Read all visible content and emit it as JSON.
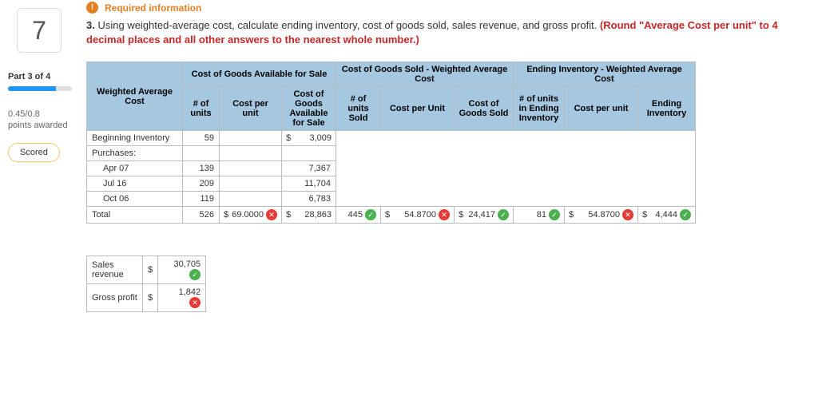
{
  "sidebar": {
    "question_number": "7",
    "part_label": "Part 3 of 4",
    "points": "0.45/0.8",
    "points_sub": "points awarded",
    "scored": "Scored"
  },
  "required_label": "Required information",
  "question_prefix": "3. ",
  "question_text": "Using weighted-average cost, calculate ending inventory, cost of goods sold, sales revenue, and gross profit. ",
  "question_red": "(Round \"Average Cost per unit\" to 4 decimal places and all other answers to the nearest whole number.)",
  "table": {
    "corner_header": "Weighted Average Cost",
    "group_headers": {
      "g1": "Cost of Goods Available for Sale",
      "g2": "Cost of Goods Sold - Weighted Average Cost",
      "g3": "Ending Inventory - Weighted Average Cost"
    },
    "sub_headers": {
      "c1": "# of units",
      "c2": "Cost per unit",
      "c3": "Cost of Goods Available for Sale",
      "c4": "# of units Sold",
      "c5": "Cost per Unit",
      "c6": "Cost of Goods Sold",
      "c7": "# of units in Ending Inventory",
      "c8": "Cost per unit",
      "c9": "Ending Inventory"
    },
    "rows": {
      "r1": {
        "label": "Beginning Inventory",
        "units": "59",
        "cga_sym": "$",
        "cga": "3,009"
      },
      "r2": {
        "label": "Purchases:"
      },
      "r3": {
        "label": "Apr 07",
        "units": "139",
        "cga": "7,367"
      },
      "r4": {
        "label": "Jul 16",
        "units": "209",
        "cga": "11,704"
      },
      "r5": {
        "label": "Oct 06",
        "units": "119",
        "cga": "6,783"
      },
      "r6": {
        "label": "Total",
        "units": "526",
        "cpu_sym": "$",
        "cpu": "69.0000",
        "cga_sym": "$",
        "cga": "28,863",
        "sold_units": "445",
        "sold_cpu_sym": "$",
        "sold_cpu": "54.8700",
        "cogs_sym": "$",
        "cogs": "24,417",
        "end_units": "81",
        "end_cpu_sym": "$",
        "end_cpu": "54.8700",
        "end_inv_sym": "$",
        "end_inv": "4,444"
      }
    }
  },
  "small_table": {
    "r1_label": "Sales revenue",
    "r1_sym": "$",
    "r1_val": "30,705",
    "r2_label": "Gross profit",
    "r2_sym": "$",
    "r2_val": "1,842"
  },
  "chart_data": {
    "type": "table",
    "title": "Weighted Average Cost",
    "rows": [
      {
        "label": "Beginning Inventory",
        "units": 59,
        "cost_available": 3009
      },
      {
        "label": "Apr 07",
        "units": 139,
        "cost_available": 7367
      },
      {
        "label": "Jul 16",
        "units": 209,
        "cost_available": 11704
      },
      {
        "label": "Oct 06",
        "units": 119,
        "cost_available": 6783
      },
      {
        "label": "Total",
        "units": 526,
        "cost_per_unit": 69.0,
        "cost_available": 28863,
        "units_sold": 445,
        "cogs_cost_per_unit": 54.87,
        "cogs": 24417,
        "ending_units": 81,
        "ending_cost_per_unit": 54.87,
        "ending_inventory": 4444
      }
    ],
    "summary": {
      "sales_revenue": 30705,
      "gross_profit": 1842
    }
  }
}
